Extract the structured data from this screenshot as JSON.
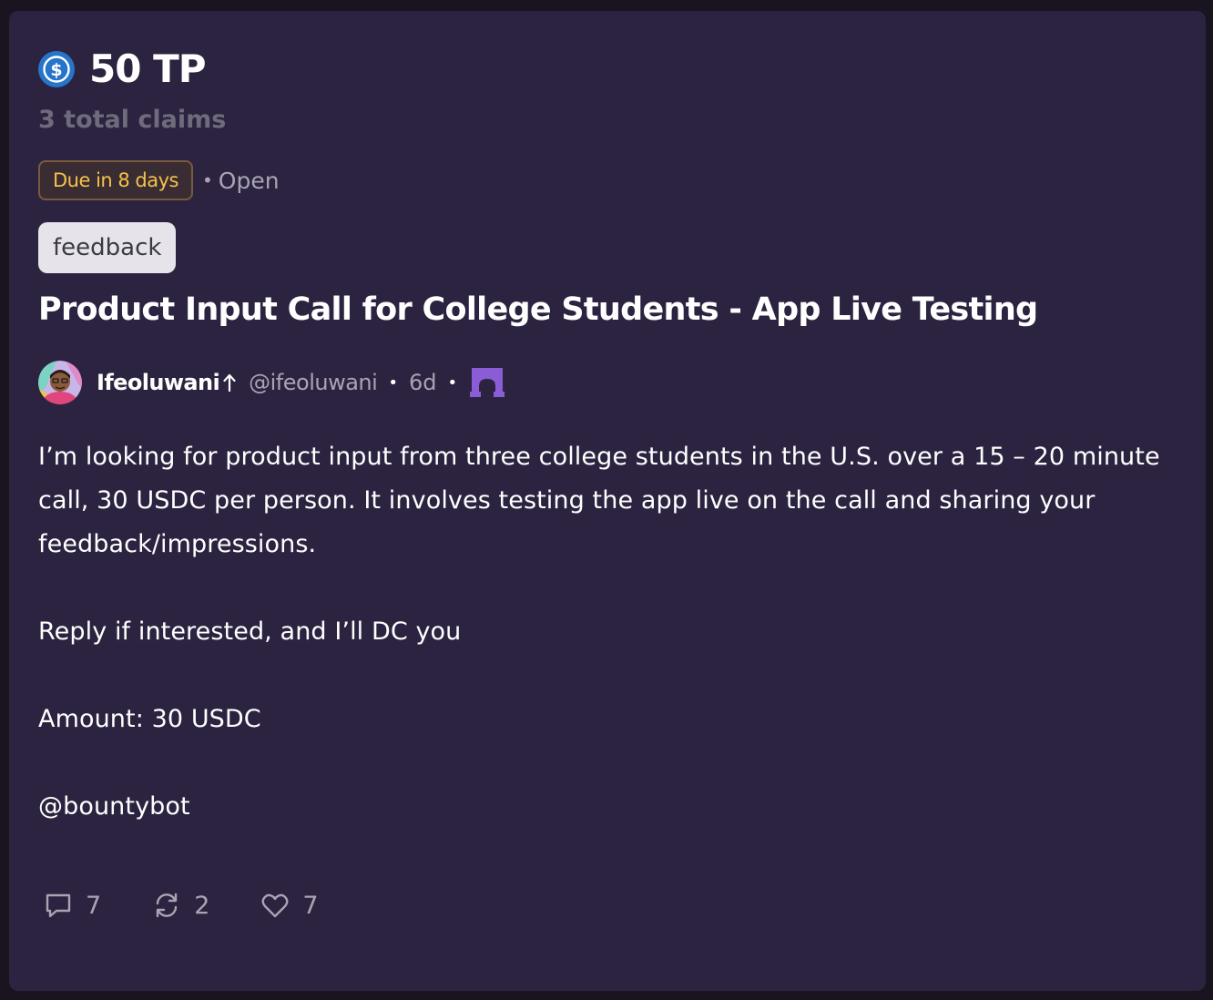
{
  "bounty": {
    "reward": "50 TP",
    "reward_icon": "usdc-coin-icon",
    "claims": "3 total claims",
    "due": "Due in 8 days",
    "status_separator": "•",
    "status": "Open",
    "tag": "feedback",
    "title": "Product Input Call for College Students - App Live Testing"
  },
  "author": {
    "name": "Ifeoluwani",
    "handle": "@ifeoluwani",
    "age": "6d",
    "separator": "•",
    "channel_icon": "arch-gate-icon"
  },
  "body": {
    "paragraph_1": "I’m looking for product input from three college students in the U.S. over a 15 – 20 minute call, 30 USDC per person. It involves testing the app live on the call and sharing your feedback/impressions.",
    "paragraph_2": "Reply if interested, and I’ll DC you",
    "paragraph_3": "Amount: 30 USDC",
    "paragraph_4": "@bountybot"
  },
  "actions": {
    "replies": "7",
    "recasts": "2",
    "likes": "7"
  },
  "colors": {
    "background": "#19141f",
    "card": "#2c2340",
    "due_text": "#f5c24a",
    "muted": "#a8a4b3",
    "channel_purple": "#8a5cd6",
    "coin_blue": "#2775ca"
  }
}
